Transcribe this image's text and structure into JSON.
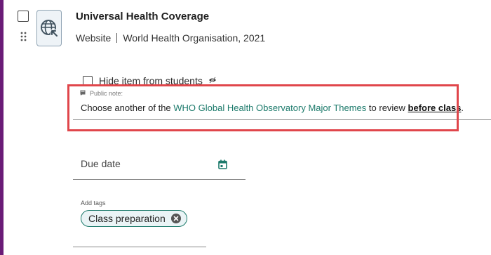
{
  "resource": {
    "title": "Universal Health Coverage",
    "type": "Website",
    "source": "World Health Organisation, 2021"
  },
  "visibility": {
    "hide_label": "Hide item from students"
  },
  "public_note": {
    "label": "Public note:",
    "text_before": "Choose another of the ",
    "link_text": "WHO Global Health Observatory Major Themes",
    "text_middle": " to review ",
    "bold_text": "before class",
    "text_after": "."
  },
  "due_date": {
    "placeholder": "Due date"
  },
  "tags": {
    "label": "Add tags",
    "items": [
      "Class preparation"
    ]
  },
  "colors": {
    "accent": "#6a1b77",
    "link": "#1c7a6b",
    "highlight": "#e0464b"
  },
  "icons": {
    "resource": "globe-link-icon",
    "drag": "drag-handle-icon",
    "hidden": "eye-off-icon",
    "note": "note-icon",
    "calendar": "calendar-icon",
    "remove_tag": "close-circle-icon"
  }
}
